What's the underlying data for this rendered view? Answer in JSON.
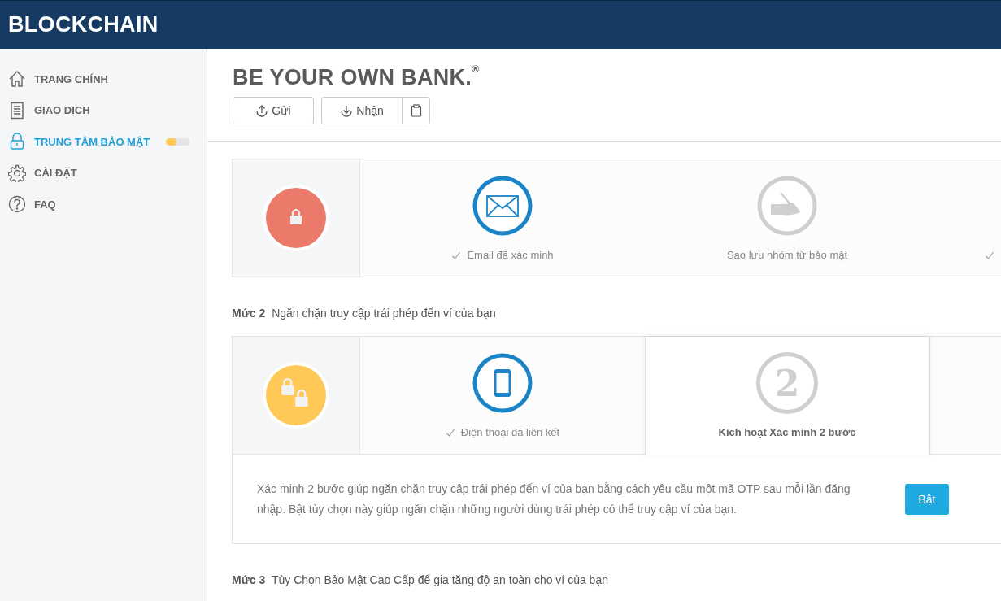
{
  "header": {
    "logo": "BLOCKCHAIN"
  },
  "sidebar": {
    "items": [
      {
        "kind": "home",
        "label": "TRANG CHÍNH",
        "selected": false
      },
      {
        "kind": "transactions",
        "label": "GIAO DỊCH",
        "selected": false
      },
      {
        "kind": "security",
        "label": "TRUNG TÂM BẢO MẬT",
        "selected": true,
        "level": 0.45
      },
      {
        "kind": "settings",
        "label": "CÀI ĐẶT",
        "selected": false
      },
      {
        "kind": "faq",
        "label": "FAQ",
        "selected": false
      }
    ]
  },
  "page": {
    "title": "BE YOUR OWN BANK.",
    "title_mark": "®",
    "buttons": [
      {
        "kind": "send",
        "label": "Gửi"
      },
      {
        "kind": "receive",
        "label": "Nhận"
      }
    ]
  },
  "levels": [
    {
      "color": "#ec7a6a",
      "kind": "single",
      "steps": [
        {
          "kind": "email",
          "label": "Email đã xác minh",
          "verified": true,
          "selected": false
        },
        {
          "kind": "backup",
          "label": "Sao lưu nhóm từ bảo mật",
          "verified": false,
          "selected": false
        },
        {
          "kind": "unknown",
          "verified": true,
          "selected": false
        }
      ]
    },
    {
      "heading": {
        "name": "Mức 2",
        "text": "Ngăn chặn truy cập trái phép đến ví của bạn"
      },
      "color": "#ffc857",
      "kind": "double",
      "steps": [
        {
          "kind": "phone",
          "label": "Điện thoại đã liên kết",
          "verified": true,
          "selected": false
        },
        {
          "kind": "number",
          "number": "2",
          "label": "Kích hoạt Xác minh 2 bước",
          "verified": false,
          "selected": true
        }
      ],
      "detail": {
        "text": "Xác minh 2 bước giúp ngăn chặn truy cập trái phép đến ví của bạn bằng cách yêu cầu một mã OTP sau mỗi lần đăng nhập. Bật tùy chọn này giúp ngăn chặn những người dùng trái phép có thể truy cập ví của bạn.",
        "button": "Bật"
      }
    },
    {
      "heading": {
        "name": "Mức 3",
        "text": "Tùy Chọn Bảo Mật Cao Cấp để gia tăng độ an toàn cho ví của bạn"
      }
    }
  ]
}
